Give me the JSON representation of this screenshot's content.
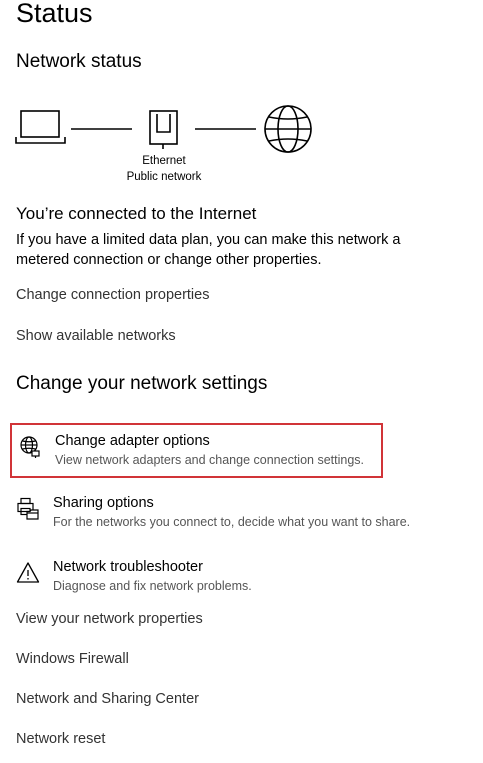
{
  "page": {
    "title": "Status"
  },
  "network_status": {
    "heading": "Network status",
    "adapter_name": "Ethernet",
    "network_profile": "Public network",
    "icons": [
      "laptop-icon",
      "ethernet-port-icon",
      "globe-icon"
    ]
  },
  "connection": {
    "title": "You’re connected to the Internet",
    "description": "If you have a limited data plan, you can make this network a metered connection or change other properties.",
    "links": [
      "Change connection properties",
      "Show available networks"
    ]
  },
  "change_settings": {
    "heading": "Change your network settings",
    "options": [
      {
        "title": "Change adapter options",
        "description": "View network adapters and change connection settings.",
        "icon": "globe-adapter-icon"
      },
      {
        "title": "Sharing options",
        "description": "For the networks you connect to, decide what you want to share.",
        "icon": "sharing-printer-icon"
      },
      {
        "title": "Network troubleshooter",
        "description": "Diagnose and fix network problems.",
        "icon": "warning-icon"
      }
    ],
    "selected_option_color": "#d13438"
  },
  "bottom_links": [
    "View your network properties",
    "Windows Firewall",
    "Network and Sharing Center",
    "Network reset"
  ]
}
